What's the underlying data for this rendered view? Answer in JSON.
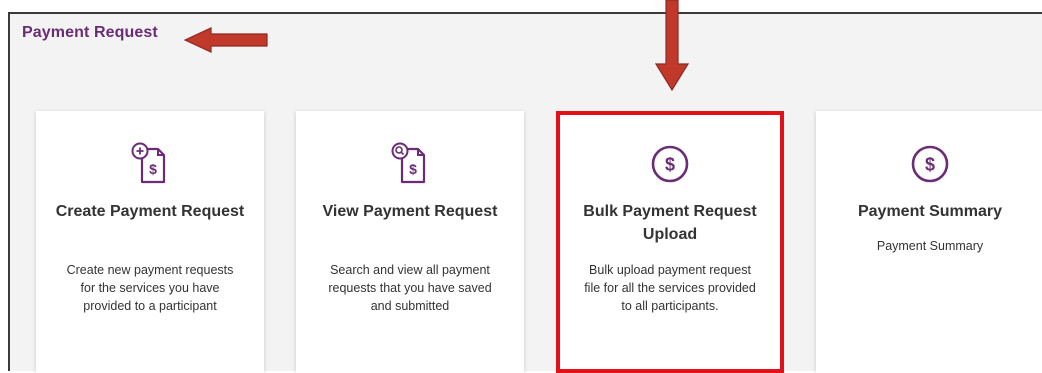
{
  "page": {
    "section_title": "Payment Request"
  },
  "colors": {
    "brand_purple": "#6b2c76",
    "arrow_red": "#c0392b",
    "highlight_red": "#e3101a"
  },
  "cards": [
    {
      "icon": "document-add-dollar-icon",
      "title": "Create Payment Request",
      "description": "Create new payment requests for the services you have provided to a participant"
    },
    {
      "icon": "document-search-dollar-icon",
      "title": "View Payment Request",
      "description": "Search and view all payment requests that you have saved and submitted"
    },
    {
      "icon": "dollar-circle-icon",
      "title": "Bulk Payment Request Upload",
      "description": "Bulk upload payment request file for all the services provided to all participants.",
      "highlighted": true
    },
    {
      "icon": "dollar-circle-icon",
      "title": "Payment Summary",
      "description": "Payment Summary"
    }
  ]
}
